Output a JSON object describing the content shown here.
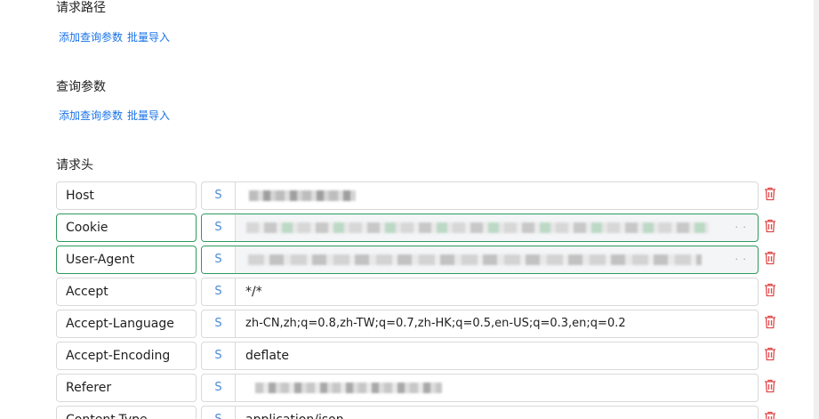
{
  "sections": {
    "path": {
      "title": "请求路径",
      "add_label": "添加查询参数",
      "bulk_label": "批量导入"
    },
    "query": {
      "title": "查询参数",
      "add_label": "添加查询参数",
      "bulk_label": "批量导入"
    },
    "headers": {
      "title": "请求头"
    }
  },
  "headers": [
    {
      "key": "Host",
      "type": "S",
      "value": ""
    },
    {
      "key": "Cookie",
      "type": "S",
      "value": ""
    },
    {
      "key": "User-Agent",
      "type": "S",
      "value": ""
    },
    {
      "key": "Accept",
      "type": "S",
      "value": "*/*"
    },
    {
      "key": "Accept-Language",
      "type": "S",
      "value": "zh-CN,zh;q=0.8,zh-TW;q=0.7,zh-HK;q=0.5,en-US;q=0.3,en;q=0.2"
    },
    {
      "key": "Accept-Encoding",
      "type": "S",
      "value": "deflate"
    },
    {
      "key": "Referer",
      "type": "S",
      "value": ""
    },
    {
      "key": "Content-Type",
      "type": "S",
      "value": "application/json"
    }
  ],
  "icons": {
    "delete": "trash-icon",
    "type": "string-type-icon"
  },
  "colors": {
    "link": "#1a73e8",
    "delete": "#e04a4a",
    "active_border": "#2e9a5f",
    "type_icon": "#4a8ad8"
  }
}
